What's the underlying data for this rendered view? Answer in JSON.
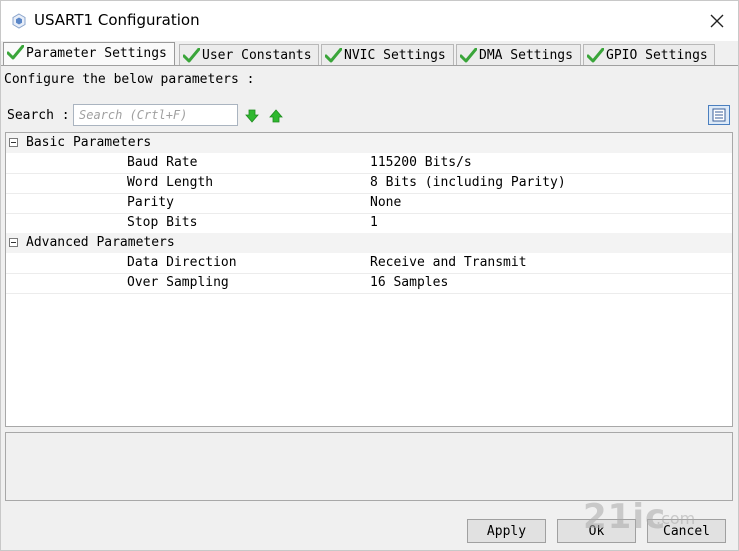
{
  "window": {
    "title": "USART1 Configuration"
  },
  "tabs": [
    {
      "label": "Parameter Settings"
    },
    {
      "label": "User Constants"
    },
    {
      "label": "NVIC Settings"
    },
    {
      "label": "DMA Settings"
    },
    {
      "label": "GPIO Settings"
    }
  ],
  "configure_text": "Configure the below parameters :",
  "search": {
    "label": "Search :",
    "placeholder": "Search (Crtl+F)"
  },
  "groups": {
    "basic": {
      "label": "Basic Parameters",
      "params": [
        {
          "name": "Baud Rate",
          "value": "115200 Bits/s"
        },
        {
          "name": "Word Length",
          "value": "8 Bits (including Parity)"
        },
        {
          "name": "Parity",
          "value": "None"
        },
        {
          "name": "Stop Bits",
          "value": "1"
        }
      ]
    },
    "advanced": {
      "label": "Advanced Parameters",
      "params": [
        {
          "name": "Data Direction",
          "value": "Receive and Transmit"
        },
        {
          "name": "Over Sampling",
          "value": "16 Samples"
        }
      ]
    }
  },
  "buttons": {
    "apply": "Apply",
    "ok": "Ok",
    "cancel": "Cancel"
  },
  "colors": {
    "check": "#3aa53a",
    "arrow": "#2fb82f",
    "accent": "#4b7fbf"
  }
}
